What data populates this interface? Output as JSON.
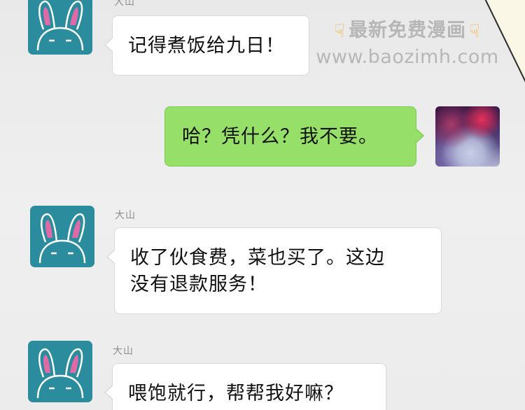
{
  "messages": [
    {
      "sender": "大山",
      "text": "记得煮饭给九日！",
      "side": "left"
    },
    {
      "sender": "",
      "text": "哈？凭什么？我不要。",
      "side": "right"
    },
    {
      "sender": "大山",
      "text": "收了伙食费，菜也买了。这边",
      "text_line2": "没有退款服务！",
      "side": "left"
    },
    {
      "sender": "大山",
      "text": "喂饱就行，帮帮我好嘛？",
      "side": "left"
    }
  ],
  "watermark": {
    "line1": "最新免费漫画",
    "line2": "www.baozimh.com",
    "icon": "pointing-down-hand-icon"
  },
  "avatars": {
    "dashan": "bunny-face-icon",
    "self": "nebula-avatar-image"
  },
  "colors": {
    "avatar_bg": "#2a8c9c",
    "self_bubble": "#96e069",
    "other_bubble": "#ffffff",
    "background": "#ececec"
  }
}
